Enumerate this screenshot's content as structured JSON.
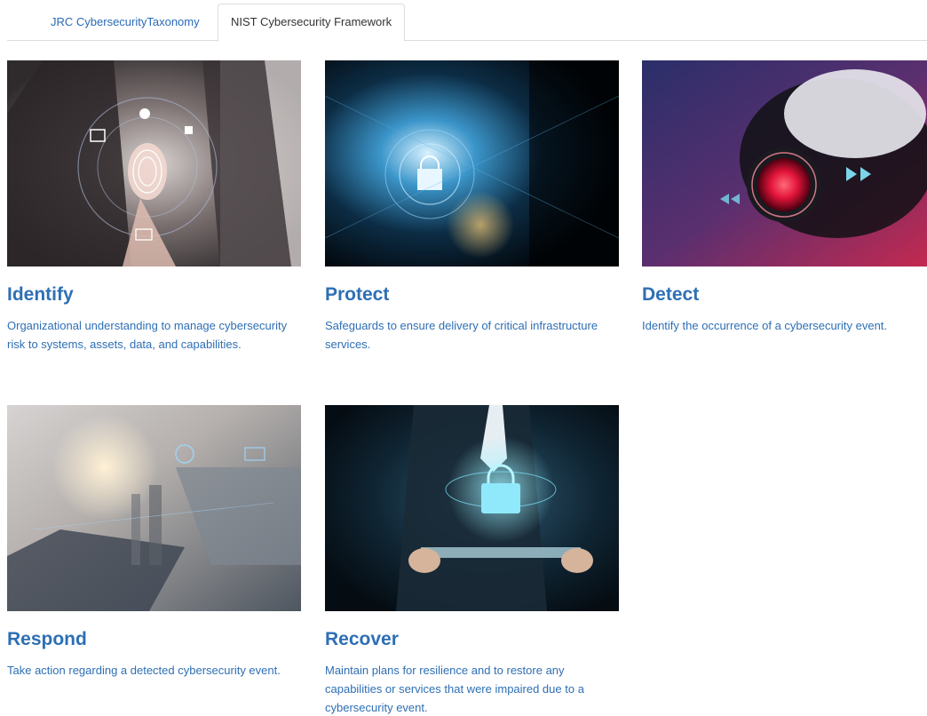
{
  "tabs": [
    {
      "label": "JRC CybersecurityTaxonomy",
      "active": false
    },
    {
      "label": "NIST Cybersecurity Framework",
      "active": true
    }
  ],
  "cards": [
    {
      "title": "Identify",
      "description": "Organizational understanding to manage cybersecurity risk to systems, assets, data, and capabilities.",
      "image": "fingerprint-touch-image"
    },
    {
      "title": "Protect",
      "description": "Safeguards to ensure delivery of critical infrastructure services.",
      "image": "padlock-circuit-image"
    },
    {
      "title": "Detect",
      "description": "Identify the occurrence of a cybersecurity event.",
      "image": "security-camera-image"
    },
    {
      "title": "Respond",
      "description": "Take action regarding a detected cybersecurity event.",
      "image": "laptop-city-network-image"
    },
    {
      "title": "Recover",
      "description": "Maintain plans for resilience and to restore any capabilities or services that were impaired due to a cybersecurity event.",
      "image": "businessman-tablet-lock-image"
    }
  ],
  "colors": {
    "title": "#2e6fb4",
    "link": "#2a6ab8",
    "tab_border": "#dddddd"
  }
}
